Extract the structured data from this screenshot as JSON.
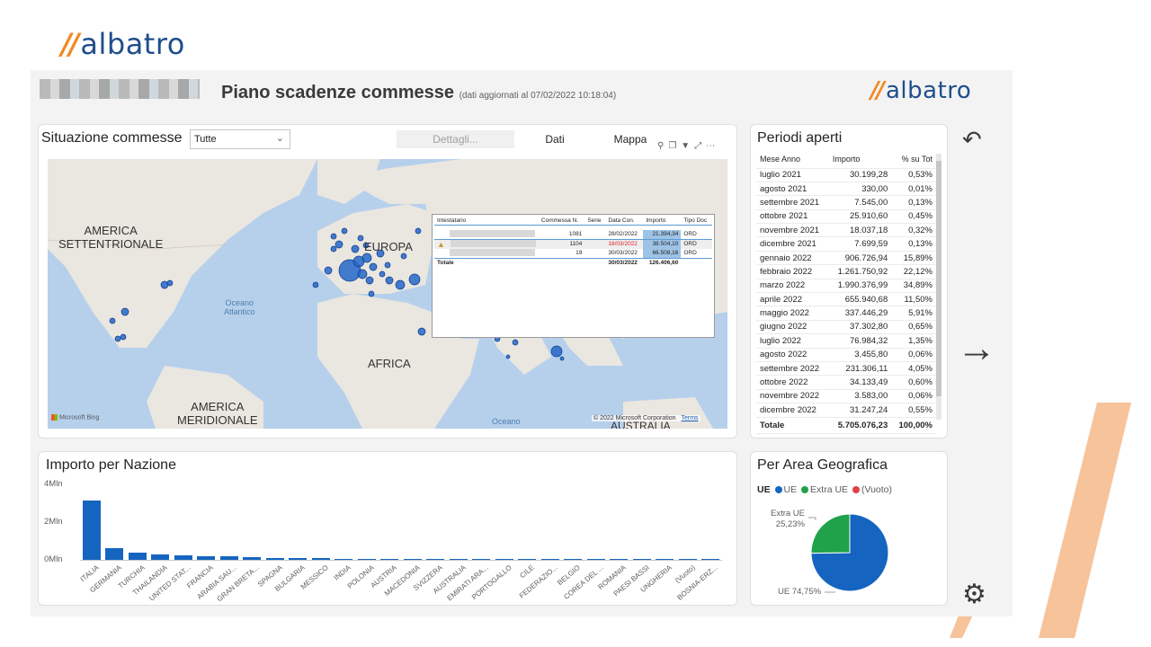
{
  "brand": {
    "slash": "//",
    "name": "albatro"
  },
  "header": {
    "title": "Piano scadenze commesse",
    "subtitle": "(dati aggiornati al 07/02/2022 10:18:04)"
  },
  "situazione": {
    "title": "Situazione commesse",
    "filter_value": "Tutte",
    "tab_details": "Dettagli...",
    "tab_data": "Dati",
    "tab_map": "Mappa",
    "map_labels": {
      "na": "AMERICA\nSETTENTRIONALE",
      "europa": "EUROPA",
      "ocean_atl": "Oceano\nAtlantico",
      "africa": "AFRICA",
      "sa": "AMERICA\nMERIDIONALE",
      "ocean_bottom": "Oceano",
      "australia": "AUSTRALIA",
      "bing": "Microsoft Bing",
      "copyright": "© 2022 Microsoft Corporation",
      "terms": "Terms"
    },
    "tooltip": {
      "headers": [
        "Intestatario",
        "Commessa N.",
        "Serie",
        "Data Con.",
        "Importo",
        "Tipo Doc"
      ],
      "rows": [
        {
          "commessa": "1081",
          "data": "28/02/2022",
          "importo": "21.394,34",
          "tipo": "ORD"
        },
        {
          "commessa": "1104",
          "data": "18/03/2022",
          "importo": "38.504,10",
          "tipo": "ORD"
        },
        {
          "commessa": "19",
          "data": "30/03/2022",
          "importo": "66.508,16",
          "tipo": "ORD"
        }
      ],
      "total_label": "Totale",
      "total_data": "30/03/2022",
      "total_importo": "126.406,60"
    }
  },
  "periodi": {
    "title": "Periodi aperti",
    "headers": [
      "Mese Anno",
      "Importo",
      "% su Tot"
    ],
    "rows": [
      [
        "luglio 2021",
        "30.199,28",
        "0,53%"
      ],
      [
        "agosto 2021",
        "330,00",
        "0,01%"
      ],
      [
        "settembre 2021",
        "7.545,00",
        "0,13%"
      ],
      [
        "ottobre 2021",
        "25.910,60",
        "0,45%"
      ],
      [
        "novembre 2021",
        "18.037,18",
        "0,32%"
      ],
      [
        "dicembre 2021",
        "7.699,59",
        "0,13%"
      ],
      [
        "gennaio 2022",
        "906.726,94",
        "15,89%"
      ],
      [
        "febbraio 2022",
        "1.261.750,92",
        "22,12%"
      ],
      [
        "marzo 2022",
        "1.990.376,99",
        "34,89%"
      ],
      [
        "aprile 2022",
        "655.940,68",
        "11,50%"
      ],
      [
        "maggio 2022",
        "337.446,29",
        "5,91%"
      ],
      [
        "giugno 2022",
        "37.302,80",
        "0,65%"
      ],
      [
        "luglio 2022",
        "76.984,32",
        "1,35%"
      ],
      [
        "agosto 2022",
        "3.455,80",
        "0,06%"
      ],
      [
        "settembre 2022",
        "231.306,11",
        "4,05%"
      ],
      [
        "ottobre 2022",
        "34.133,49",
        "0,60%"
      ],
      [
        "novembre 2022",
        "3.583,00",
        "0,06%"
      ],
      [
        "dicembre 2022",
        "31.247,24",
        "0,55%"
      ]
    ],
    "total": [
      "Totale",
      "5.705.076,23",
      "100,00%"
    ]
  },
  "importo_nazione": {
    "title": "Importo per Nazione"
  },
  "area": {
    "title": "Per Area Geografica",
    "legend_title": "UE",
    "legend": [
      {
        "label": "UE",
        "color": "#1565c0"
      },
      {
        "label": "Extra UE",
        "color": "#1fa24a"
      },
      {
        "label": "(Vuoto)",
        "color": "#e0404a"
      }
    ],
    "label_extra_name": "Extra UE",
    "label_extra_pct": "25,23%",
    "label_ue": "UE 74,75%"
  },
  "chart_data": {
    "type": "bar",
    "title": "Importo per Nazione",
    "ylim": [
      0,
      4000000
    ],
    "yticks": [
      "0Mln",
      "2Mln",
      "4Mln"
    ],
    "categories": [
      "ITALIA",
      "GERMANIA",
      "TURCHIA",
      "THAILANDIA",
      "UNITED STAT...",
      "FRANCIA",
      "ARABIA SAU...",
      "GRAN BRETA...",
      "SPAGNA",
      "BULGARIA",
      "MESSICO",
      "INDIA",
      "POLONIA",
      "AUSTRIA",
      "MACEDONIA",
      "SVIZZERA",
      "AUSTRALIA",
      "EMIRATI ARA...",
      "PORTOGALLO",
      "CILE",
      "FEDERAZIO...",
      "BELGIO",
      "COREA DEL ...",
      "ROMANIA",
      "PAESI BASSI",
      "UNGHERIA",
      "(Vuoto)",
      "BOSNIA-ERZ..."
    ],
    "values": [
      3150000,
      620000,
      400000,
      290000,
      250000,
      210000,
      170000,
      140000,
      110000,
      90000,
      80000,
      70000,
      60000,
      55000,
      50000,
      45000,
      40000,
      35000,
      30000,
      28000,
      25000,
      22000,
      20000,
      18000,
      15000,
      12000,
      10000,
      8000
    ],
    "pie": {
      "categories": [
        "UE",
        "Extra UE"
      ],
      "values": [
        74.75,
        25.23
      ]
    }
  }
}
